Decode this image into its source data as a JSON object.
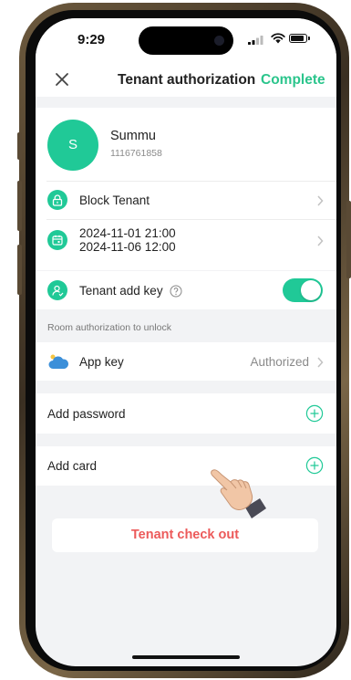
{
  "status_bar": {
    "time": "9:29"
  },
  "nav": {
    "title": "Tenant authorization",
    "complete_label": "Complete"
  },
  "user": {
    "avatar_letter": "S",
    "name": "Summu",
    "phone": "1116761858"
  },
  "block": {
    "label": "Block Tenant"
  },
  "period": {
    "start": "2024-11-01 21:00",
    "end": "2024-11-06 12:00"
  },
  "tenant_add_key": {
    "label": "Tenant add key",
    "enabled": true
  },
  "unlock_section": {
    "label": "Room authorization to unlock"
  },
  "app_key": {
    "label": "App key",
    "status": "Authorized"
  },
  "add_password": {
    "label": "Add password"
  },
  "add_card": {
    "label": "Add card"
  },
  "checkout": {
    "label": "Tenant check out"
  },
  "colors": {
    "accent": "#20c997",
    "accent_text": "#2bc58c",
    "danger": "#ec5a5a",
    "background": "#f2f3f5"
  },
  "icons": [
    "close-icon",
    "lock-icon",
    "calendar-icon",
    "user-key-icon",
    "help-icon",
    "cloud-icon",
    "plus-circle-icon",
    "chevron-right-icon",
    "pointing-hand-icon"
  ]
}
